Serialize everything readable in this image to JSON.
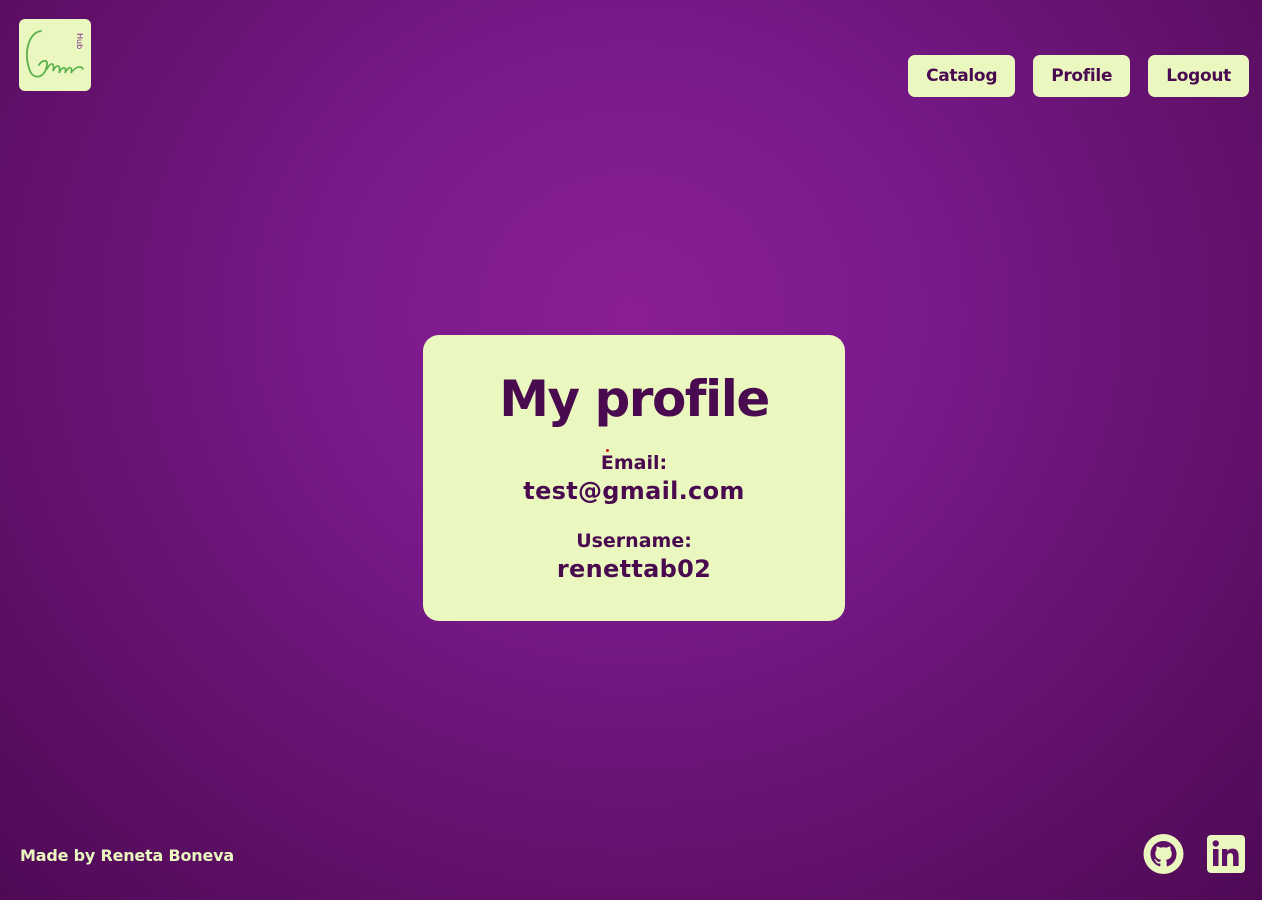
{
  "colors": {
    "accent": "#eaf7bf",
    "text": "#4a0a4f",
    "background": "#78198a"
  },
  "logo": {
    "text": "Game Hub",
    "script_text": "Game",
    "small_text": "Hub"
  },
  "nav": {
    "items": [
      {
        "label": "Catalog"
      },
      {
        "label": "Profile"
      },
      {
        "label": "Logout"
      }
    ]
  },
  "profile": {
    "title": "My profile",
    "email_label": "Email:",
    "email_value": "test@gmail.com",
    "username_label": "Username:",
    "username_value": "renettab02"
  },
  "footer": {
    "credit": "Made by Reneta Boneva",
    "icons": [
      "github-icon",
      "linkedin-icon"
    ]
  }
}
